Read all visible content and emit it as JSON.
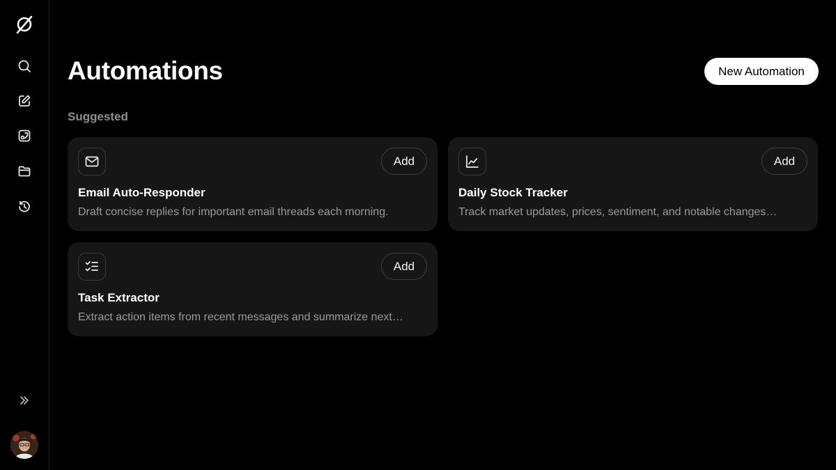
{
  "sidebar": {
    "icons": {
      "logo": "slashed-circle-logo",
      "search": "search-icon",
      "compose": "compose-icon",
      "spaces": "spaces-icon",
      "files": "folder-icon",
      "history": "history-icon",
      "expand": "chevrons-right-icon"
    }
  },
  "main": {
    "title": "Automations",
    "new_button": "New Automation",
    "section_label": "Suggested",
    "cards": [
      {
        "icon": "mail-icon",
        "title": "Email Auto-Responder",
        "description": "Draft concise replies for important email threads each morning.",
        "add_label": "Add"
      },
      {
        "icon": "line-chart-icon",
        "title": "Daily Stock Tracker",
        "description": "Track market updates, prices, sentiment, and notable changes…",
        "add_label": "Add"
      },
      {
        "icon": "checklist-icon",
        "title": "Task Extractor",
        "description": "Extract action items from recent messages and summarize next…",
        "add_label": "Add"
      }
    ]
  },
  "colors": {
    "background": "#000000",
    "card": "#161616",
    "muted_text": "#9a9a9a",
    "primary_button": "#ffffff"
  }
}
